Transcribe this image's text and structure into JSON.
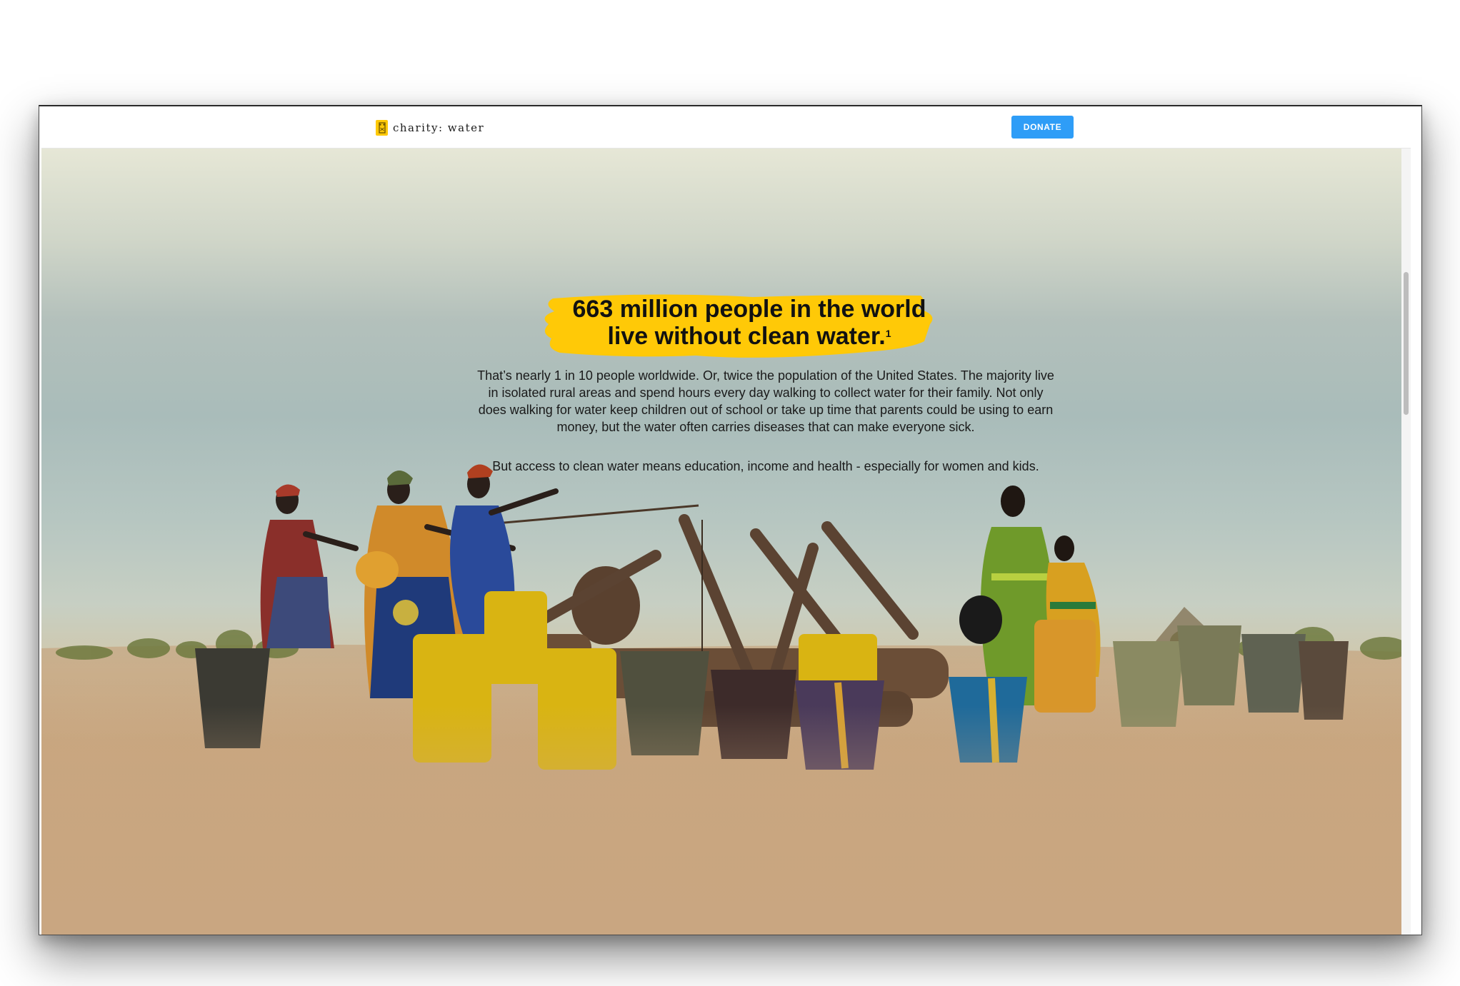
{
  "brand": {
    "name": "charity: water",
    "accent_color": "#ffc907",
    "logo_icon": "jerry-can-icon"
  },
  "nav": {
    "donate_label": "DONATE",
    "donate_color": "#2e9df7"
  },
  "hero": {
    "headline_line1": "663 million people in the world",
    "headline_line2": "live without clean water.",
    "footnote_marker": "1",
    "paragraph1": "That’s nearly 1 in 10 people worldwide. Or, twice the population of the United States. The majority live in isolated rural areas and spend hours every day walking to collect water for their family. Not only does walking for water keep children out of school or take up time that parents could be using to earn money, but the water often carries diseases that can make everyone sick.",
    "paragraph2": "But access to clean water means education, income and health - especially for women and kids.",
    "photo_description_icon": "women-at-well-photo"
  }
}
